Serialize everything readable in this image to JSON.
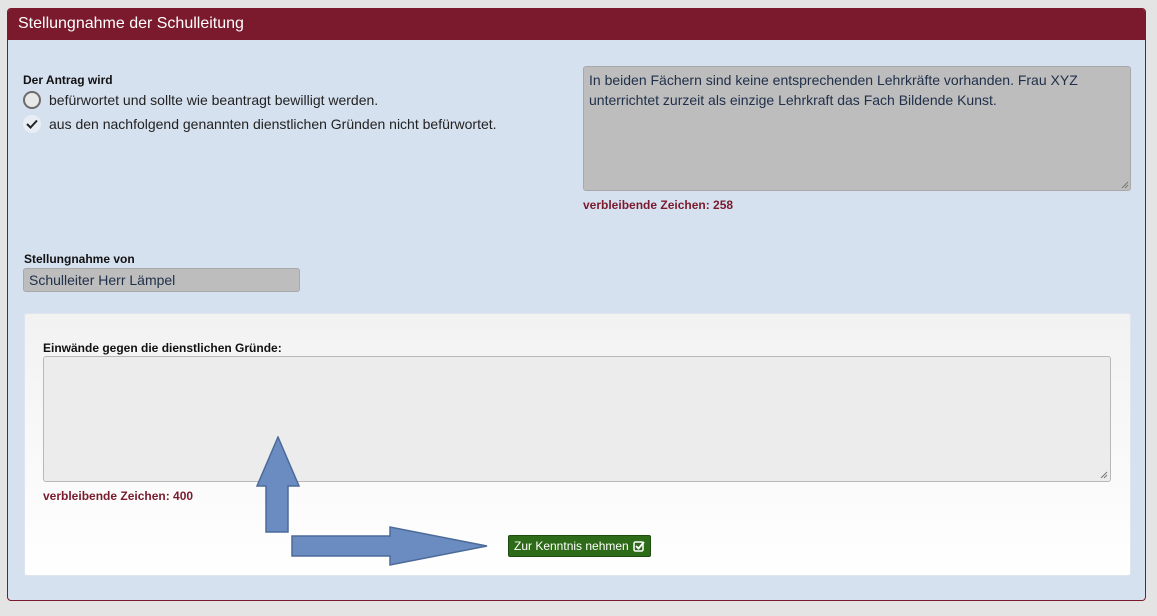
{
  "panel": {
    "title": "Stellungnahme der Schulleitung"
  },
  "antrag": {
    "label": "Der Antrag wird",
    "options": [
      {
        "label": "befürwortet und sollte wie beantragt bewilligt werden.",
        "checked": false
      },
      {
        "label": "aus den nachfolgend genannten dienstlichen Gründen nicht befürwortet.",
        "checked": true
      }
    ]
  },
  "reasons": {
    "text": "In beiden Fächern sind keine entsprechenden Lehrkräfte vorhanden. Frau XYZ unterrichtet zurzeit als einzige Lehrkraft das Fach Bildende Kunst.",
    "counter": "verbleibende Zeichen: 258"
  },
  "statement_by": {
    "label": "Stellungnahme von",
    "value": "Schulleiter Herr Lämpel"
  },
  "objections": {
    "label": "Einwände gegen die dienstlichen Gründe:",
    "value": "",
    "counter": "verbleibende Zeichen: 400"
  },
  "acknowledge_button": {
    "label": "Zur Kenntnis nehmen",
    "icon": "check-square-icon"
  },
  "colors": {
    "header": "#7b1a2d",
    "panel_bg": "#d6e1ef",
    "button": "#2e6b18",
    "counter": "#7b1a2d",
    "arrow": "#6b8cc0"
  }
}
